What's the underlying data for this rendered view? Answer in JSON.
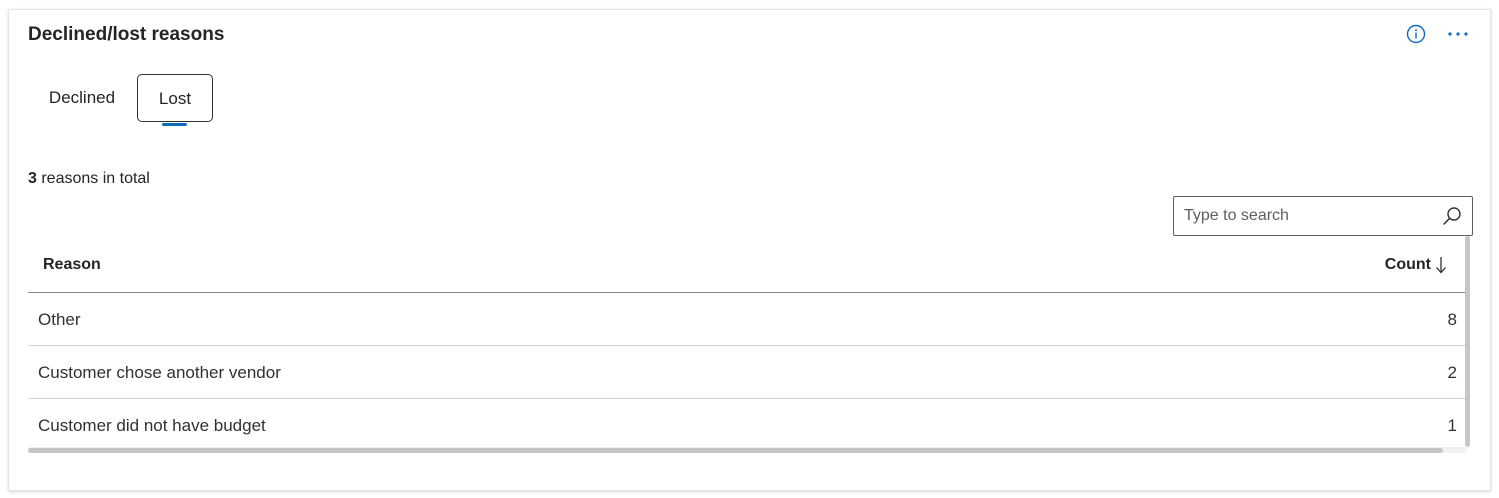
{
  "card": {
    "title": "Declined/lost reasons",
    "info_icon": "info-icon",
    "more_icon": "more-options-icon",
    "accent_color": "#0f6cbd"
  },
  "tabs": [
    {
      "label": "Declined",
      "selected": false
    },
    {
      "label": "Lost",
      "selected": true
    }
  ],
  "summary": {
    "count": "3",
    "suffix": " reasons in total"
  },
  "search": {
    "placeholder": "Type to search",
    "value": "",
    "icon": "search-icon"
  },
  "table": {
    "columns": [
      {
        "label": "Reason"
      },
      {
        "label": "Count",
        "sort": "descending",
        "sort_icon": "arrow-down-icon"
      }
    ],
    "rows": [
      {
        "reason": "Other",
        "count": "8"
      },
      {
        "reason": "Customer chose another vendor",
        "count": "2"
      },
      {
        "reason": "Customer did not have budget",
        "count": "1"
      }
    ]
  }
}
